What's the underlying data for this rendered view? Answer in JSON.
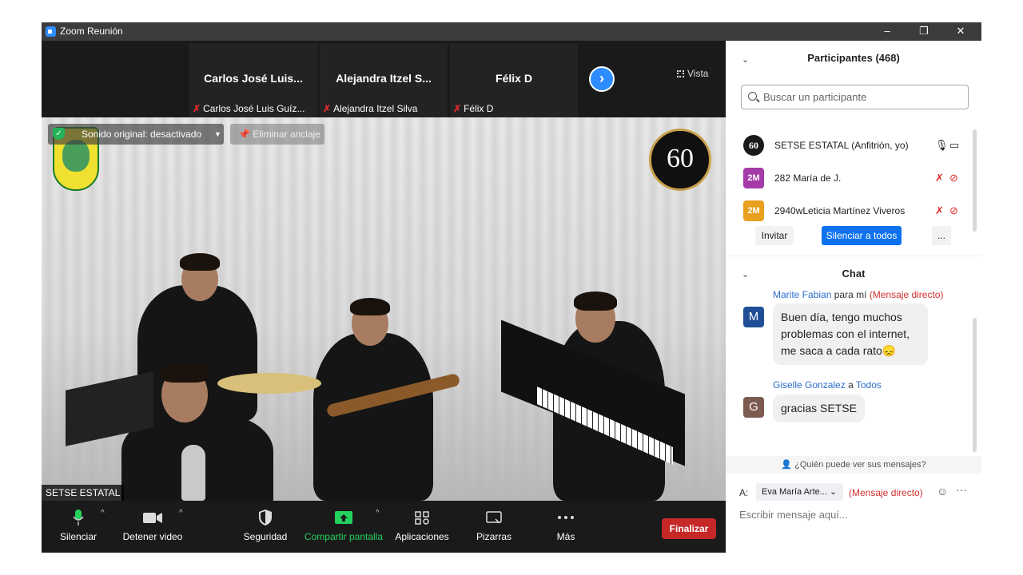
{
  "window": {
    "title": "Zoom Reunión",
    "minimize": "–",
    "restore": "❐",
    "close": "✕"
  },
  "strip": {
    "tiles": [
      {
        "name": "Carlos José Luis...",
        "sub": "Carlos José Luis Guíz..."
      },
      {
        "name": "Alejandra Itzel S...",
        "sub": "Alejandra Itzel Silva"
      },
      {
        "name": "Félix D",
        "sub": "Félix D"
      }
    ],
    "next": "›",
    "view_label": "Vista"
  },
  "video": {
    "sound_badge": "Sonido original: desactivado",
    "pin_badge": "Eliminar anclaje",
    "logo_60": "60",
    "name_label": "SETSE ESTATAL"
  },
  "toolbar": {
    "mute": "Silenciar",
    "video": "Detener video",
    "security": "Seguridad",
    "share": "Compartir pantalla",
    "apps": "Aplicaciones",
    "whiteboards": "Pizarras",
    "more": "Más",
    "end": "Finalizar"
  },
  "participants": {
    "header": "Participantes (468)",
    "search_placeholder": "Buscar un participante",
    "list": [
      {
        "avatar": "60",
        "name": "SETSE ESTATAL (Anfitrión, yo)",
        "avatar_color": "#1a1a1a"
      },
      {
        "avatar": "2M",
        "name": "282 María de J.",
        "avatar_color": "#a43ba8"
      },
      {
        "avatar": "2M",
        "name": "2940wLeticia Martínez Viveros",
        "avatar_color": "#e8a01e"
      }
    ],
    "invite": "Invitar",
    "mute_all": "Silenciar a todos",
    "more": "..."
  },
  "chat": {
    "header": "Chat",
    "messages": [
      {
        "sender": "Marite Fabian",
        "connector": "para mí",
        "target": "(Mensaje directo)",
        "avatar": "M",
        "avatar_color": "#1f4e96",
        "text": "Buen día, tengo muchos problemas con el internet, me saca a cada rato😞"
      },
      {
        "sender": "Giselle Gonzalez",
        "connector": "a",
        "target": "Todos",
        "avatar": "G",
        "avatar_color": "#7d5a50",
        "text": "gracias SETSE"
      }
    ],
    "who_sees": "¿Quién puede ver sus mensajes?",
    "to_label": "A:",
    "to_value": "Eva María Arte...",
    "to_type": "(Mensaje directo)",
    "input_placeholder": "Escribir mensaje aquí..."
  }
}
